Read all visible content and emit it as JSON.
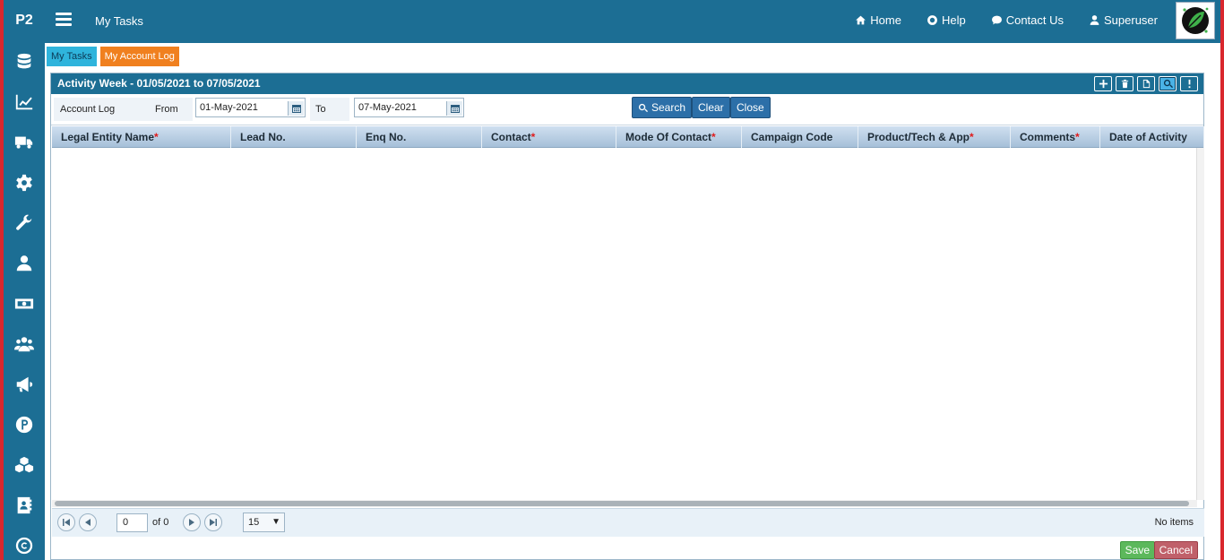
{
  "brand": "P2",
  "header": {
    "title": "My Tasks",
    "links": [
      {
        "label": "Home",
        "icon": "home-icon"
      },
      {
        "label": "Help",
        "icon": "lifebuoy-icon"
      },
      {
        "label": "Contact Us",
        "icon": "chat-icon"
      },
      {
        "label": "Superuser",
        "icon": "user-icon"
      }
    ]
  },
  "sidebar": {
    "items": [
      "database-icon",
      "line-chart-icon",
      "truck-icon",
      "gear-icon",
      "wrench-icon",
      "user-icon",
      "money-icon",
      "group-icon",
      "megaphone-icon",
      "parking-icon",
      "cubes-icon",
      "contact-book-icon",
      "copyright-icon"
    ]
  },
  "tabs": [
    "My Tasks",
    "My Account Log"
  ],
  "panel": {
    "title": "Activity Week - 01/05/2021 to 07/05/2021",
    "tools": [
      "add-icon",
      "delete-icon",
      "export-icon",
      "search-icon",
      "more-icon"
    ]
  },
  "filter": {
    "account_log_label": "Account Log",
    "from_label": "From",
    "from_value": "01-May-2021",
    "to_label": "To",
    "to_value": "07-May-2021",
    "search_label": "Search",
    "clear_label": "Clear",
    "close_label": "Close"
  },
  "grid": {
    "columns": [
      {
        "label": "Legal Entity Name",
        "required": true
      },
      {
        "label": "Lead No.",
        "required": false
      },
      {
        "label": "Enq No.",
        "required": false
      },
      {
        "label": "Contact",
        "required": true
      },
      {
        "label": "Mode Of Contact",
        "required": true
      },
      {
        "label": "Campaign Code",
        "required": false
      },
      {
        "label": "Product/Tech & App",
        "required": true
      },
      {
        "label": "Comments",
        "required": true
      },
      {
        "label": "Date of Activity",
        "required": false
      }
    ]
  },
  "pager": {
    "page": "0",
    "of_text": "of 0",
    "page_size": "15",
    "count_text": "No items"
  },
  "actions": {
    "save": "Save",
    "cancel": "Cancel"
  },
  "colors": {
    "primary": "#1c6e94",
    "tab_active": "#f0801f",
    "tab_inactive": "#2fb4dc",
    "required": "#e01b1b"
  }
}
